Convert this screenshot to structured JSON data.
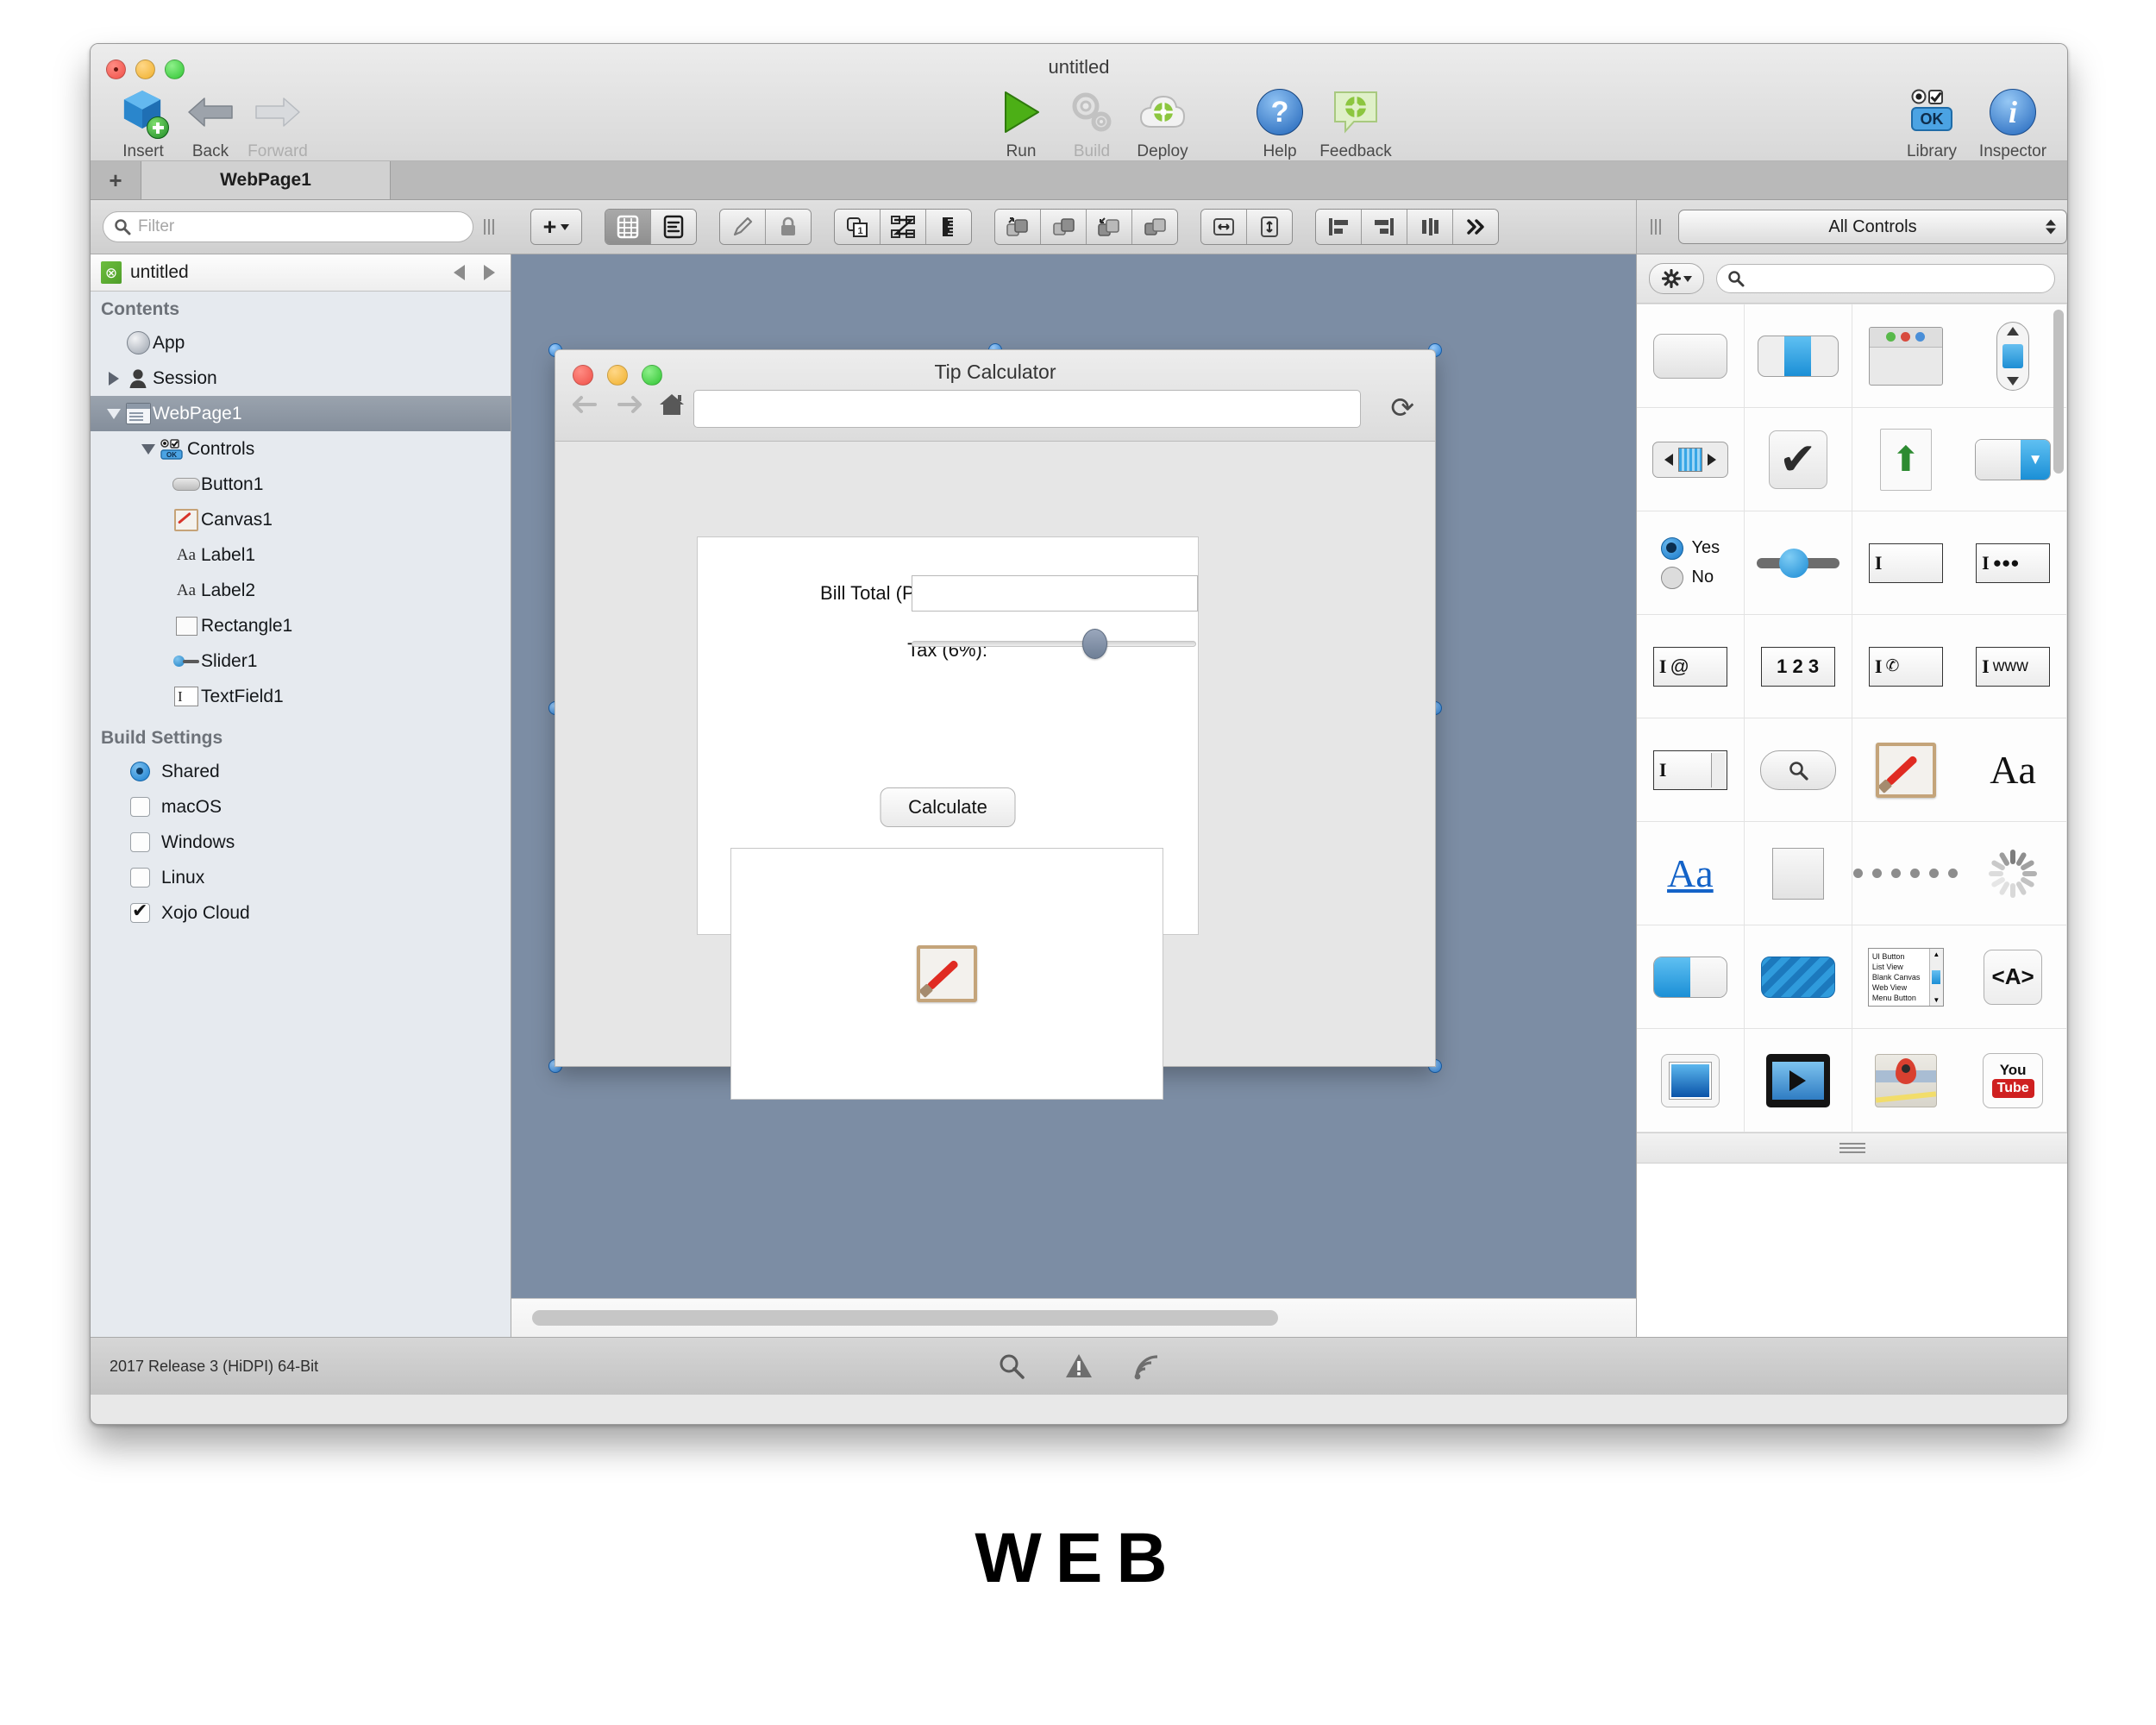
{
  "window": {
    "title": "untitled"
  },
  "toolbar": {
    "left": [
      {
        "label": "Insert",
        "icon": "cube-plus-icon",
        "disabled": false
      },
      {
        "label": "Back",
        "icon": "arrow-left-icon",
        "disabled": false
      },
      {
        "label": "Forward",
        "icon": "arrow-right-icon",
        "disabled": true
      }
    ],
    "center": [
      {
        "label": "Run",
        "icon": "play-triangle-icon",
        "disabled": false
      },
      {
        "label": "Build",
        "icon": "gears-icon",
        "disabled": true
      },
      {
        "label": "Deploy",
        "icon": "cloud-icon",
        "disabled": false
      }
    ],
    "help_group": [
      {
        "label": "Help",
        "icon": "question-circle-icon",
        "disabled": false
      },
      {
        "label": "Feedback",
        "icon": "speech-bubble-icon",
        "disabled": false
      }
    ],
    "right": [
      {
        "label": "Library",
        "icon": "controls-ok-icon",
        "disabled": false
      },
      {
        "label": "Inspector",
        "icon": "info-circle-icon",
        "disabled": false
      }
    ]
  },
  "tabs": {
    "add_label": "+",
    "items": [
      {
        "label": "WebPage1",
        "active": true
      }
    ]
  },
  "filter": {
    "placeholder": "Filter",
    "icon": "search-icon"
  },
  "layout_toolbar": {
    "groups": [
      {
        "buttons": [
          {
            "icon": "add-dropdown-icon",
            "label": "+"
          }
        ]
      },
      {
        "buttons": [
          {
            "icon": "grid-view-icon",
            "active": true
          },
          {
            "icon": "list-view-icon",
            "active": false
          }
        ]
      },
      {
        "buttons": [
          {
            "icon": "pencil-icon"
          },
          {
            "icon": "lock-icon"
          }
        ]
      },
      {
        "buttons": [
          {
            "icon": "page-number-icon"
          },
          {
            "icon": "tab-order-icon"
          },
          {
            "icon": "ruler-icon"
          }
        ]
      },
      {
        "buttons": [
          {
            "icon": "bring-forward-icon"
          },
          {
            "icon": "bring-front-icon"
          },
          {
            "icon": "send-backward-icon"
          },
          {
            "icon": "send-back-icon"
          }
        ]
      },
      {
        "buttons": [
          {
            "icon": "resize-horizontal-icon"
          },
          {
            "icon": "resize-vertical-icon"
          }
        ]
      },
      {
        "buttons": [
          {
            "icon": "align-left-icon"
          },
          {
            "icon": "align-right-icon"
          },
          {
            "icon": "distribute-icon"
          },
          {
            "icon": "more-chevrons-icon"
          }
        ]
      }
    ]
  },
  "library_selector": {
    "value": "All Controls",
    "grip_icon": "drag-grip-icon"
  },
  "sidebar": {
    "project_name": "untitled",
    "project_icon": "xojo-project-icon",
    "nav_back_icon": "nav-back-icon",
    "nav_forward_icon": "nav-forward-icon",
    "contents_title": "Contents",
    "contents": [
      {
        "label": "App",
        "icon": "app-globe-icon",
        "indent": 1,
        "disclosure": "none",
        "selected": false
      },
      {
        "label": "Session",
        "icon": "session-person-icon",
        "indent": 1,
        "disclosure": "right",
        "selected": false
      },
      {
        "label": "WebPage1",
        "icon": "webpage-icon",
        "indent": 1,
        "disclosure": "down",
        "selected": true
      },
      {
        "label": "Controls",
        "icon": "controls-group-icon",
        "indent": 2,
        "disclosure": "down",
        "selected": false
      },
      {
        "label": "Button1",
        "icon": "button-icon",
        "indent": 3,
        "disclosure": "none",
        "selected": false
      },
      {
        "label": "Canvas1",
        "icon": "canvas-icon",
        "indent": 3,
        "disclosure": "none",
        "selected": false
      },
      {
        "label": "Label1",
        "icon": "label-aa-icon",
        "indent": 3,
        "disclosure": "none",
        "selected": false
      },
      {
        "label": "Label2",
        "icon": "label-aa-icon",
        "indent": 3,
        "disclosure": "none",
        "selected": false
      },
      {
        "label": "Rectangle1",
        "icon": "rectangle-icon",
        "indent": 3,
        "disclosure": "none",
        "selected": false
      },
      {
        "label": "Slider1",
        "icon": "slider-icon",
        "indent": 3,
        "disclosure": "none",
        "selected": false
      },
      {
        "label": "TextField1",
        "icon": "textfield-icon",
        "indent": 3,
        "disclosure": "none",
        "selected": false
      }
    ],
    "build_settings_title": "Build Settings",
    "build_settings": [
      {
        "label": "Shared",
        "control": "radio",
        "checked": true
      },
      {
        "label": "macOS",
        "control": "checkbox",
        "checked": false
      },
      {
        "label": "Windows",
        "control": "checkbox",
        "checked": false
      },
      {
        "label": "Linux",
        "control": "checkbox",
        "checked": false
      },
      {
        "label": "Xojo Cloud",
        "control": "checkbox",
        "checked": true
      }
    ]
  },
  "preview": {
    "window_title": "Tip Calculator",
    "browser": {
      "back_icon": "browser-back-icon",
      "forward_icon": "browser-forward-icon",
      "home_icon": "home-icon",
      "url_value": "",
      "reload_icon": "reload-icon"
    },
    "form": {
      "bill_label": "Bill Total (Post-Tax):",
      "bill_value": "",
      "tax_label": "Tax (6%):",
      "tax_slider_percent": 60,
      "calculate_label": "Calculate",
      "canvas_icon": "canvas-paintbrush-icon"
    },
    "selection_handles": true
  },
  "library": {
    "gear_icon": "gear-dropdown-icon",
    "search_icon": "search-icon",
    "search_value": "",
    "resize_icon": "resize-grip-icon",
    "items": [
      {
        "name": "Button",
        "icon": "button-control-icon"
      },
      {
        "name": "SegmentedControl",
        "icon": "segmented-control-icon"
      },
      {
        "name": "Toolbar",
        "icon": "toolbar-control-icon"
      },
      {
        "name": "ScrollBar",
        "icon": "scrollbar-control-icon"
      },
      {
        "name": "Slider Horizontal",
        "icon": "hslider-control-icon"
      },
      {
        "name": "CheckBox",
        "icon": "checkbox-control-icon"
      },
      {
        "name": "FileUploader",
        "icon": "file-upload-icon"
      },
      {
        "name": "PopupMenu",
        "icon": "popup-menu-icon"
      },
      {
        "name": "RadioGroup",
        "icon": "radio-group-icon",
        "option_yes": "Yes",
        "option_no": "No"
      },
      {
        "name": "Slider",
        "icon": "slider-control-icon"
      },
      {
        "name": "TextField",
        "icon": "textfield-control-icon"
      },
      {
        "name": "PasswordField",
        "icon": "password-field-icon"
      },
      {
        "name": "EmailField",
        "icon": "email-field-icon",
        "glyph": "@"
      },
      {
        "name": "NumberField",
        "icon": "number-field-icon",
        "glyph": "1 2 3"
      },
      {
        "name": "PhoneField",
        "icon": "phone-field-icon"
      },
      {
        "name": "URLField",
        "icon": "url-field-icon",
        "glyph": "www"
      },
      {
        "name": "TextArea",
        "icon": "textarea-control-icon"
      },
      {
        "name": "SearchField",
        "icon": "search-field-icon"
      },
      {
        "name": "Canvas",
        "icon": "canvas-control-icon"
      },
      {
        "name": "Label",
        "icon": "label-control-icon",
        "glyph": "Aa"
      },
      {
        "name": "Link",
        "icon": "link-control-icon",
        "glyph": "Aa"
      },
      {
        "name": "Rectangle",
        "icon": "rectangle-control-icon"
      },
      {
        "name": "Separator",
        "icon": "separator-dots-icon"
      },
      {
        "name": "ProgressWheel",
        "icon": "progress-wheel-icon"
      },
      {
        "name": "ProgressBar",
        "icon": "progress-bar-icon"
      },
      {
        "name": "ProgressBarIndeterminate",
        "icon": "progress-bar-striped-icon"
      },
      {
        "name": "ListBox",
        "icon": "listbox-control-icon",
        "rows": [
          "UI Button",
          "List View",
          "Blank Canvas",
          "Web View",
          "Menu Button"
        ]
      },
      {
        "name": "HTMLViewer",
        "icon": "html-viewer-icon",
        "glyph": "<A>"
      },
      {
        "name": "ImageView",
        "icon": "image-view-icon"
      },
      {
        "name": "MoviePlayer",
        "icon": "movie-player-icon"
      },
      {
        "name": "MapViewer",
        "icon": "map-viewer-icon"
      },
      {
        "name": "YouTubeViewer",
        "icon": "youtube-viewer-icon",
        "glyph_top": "You",
        "glyph_bottom": "Tube"
      }
    ]
  },
  "status_bar": {
    "version": "2017 Release 3 (HiDPI) 64-Bit",
    "icons": [
      {
        "name": "search-icon"
      },
      {
        "name": "warning-triangle-icon"
      },
      {
        "name": "broadcast-icon"
      }
    ]
  },
  "caption": {
    "text": "WEB"
  }
}
